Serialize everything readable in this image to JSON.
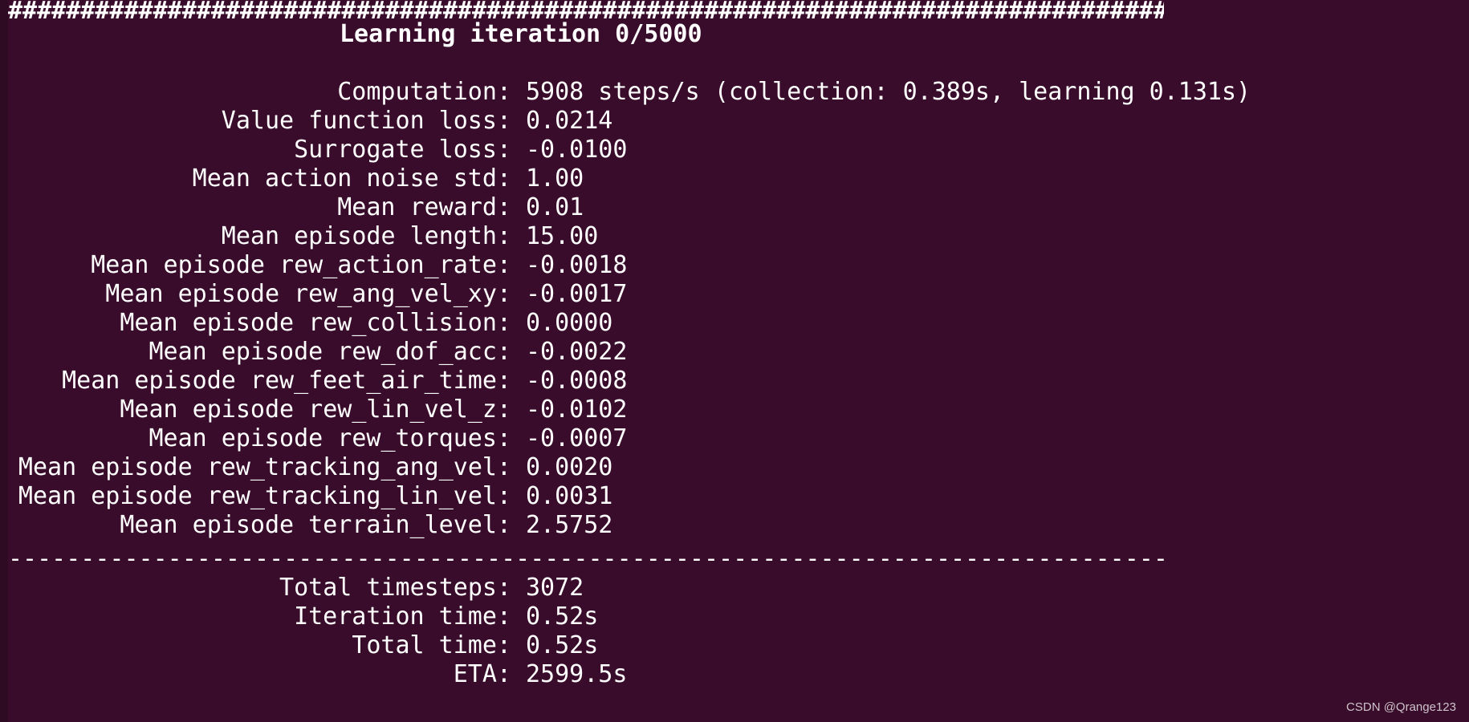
{
  "header": {
    "hash_rule": "################################################################################",
    "title": "Learning iteration 0/5000"
  },
  "stats": [
    {
      "label": "Computation:",
      "value": "5908 steps/s (collection: 0.389s, learning 0.131s)"
    },
    {
      "label": "Value function loss:",
      "value": "0.0214"
    },
    {
      "label": "Surrogate loss:",
      "value": "-0.0100"
    },
    {
      "label": "Mean action noise std:",
      "value": "1.00"
    },
    {
      "label": "Mean reward:",
      "value": "0.01"
    },
    {
      "label": "Mean episode length:",
      "value": "15.00"
    },
    {
      "label": "Mean episode rew_action_rate:",
      "value": "-0.0018"
    },
    {
      "label": "Mean episode rew_ang_vel_xy:",
      "value": "-0.0017"
    },
    {
      "label": "Mean episode rew_collision:",
      "value": "0.0000"
    },
    {
      "label": "Mean episode rew_dof_acc:",
      "value": "-0.0022"
    },
    {
      "label": "Mean episode rew_feet_air_time:",
      "value": "-0.0008"
    },
    {
      "label": "Mean episode rew_lin_vel_z:",
      "value": "-0.0102"
    },
    {
      "label": "Mean episode rew_torques:",
      "value": "-0.0007"
    },
    {
      "label": "Mean episode rew_tracking_ang_vel:",
      "value": "0.0020"
    },
    {
      "label": "Mean episode rew_tracking_lin_vel:",
      "value": "0.0031"
    },
    {
      "label": "Mean episode terrain_level:",
      "value": "2.5752"
    }
  ],
  "divider": "--------------------------------------------------------------------------------",
  "summary": [
    {
      "label": "Total timesteps:",
      "value": "3072"
    },
    {
      "label": "Iteration time:",
      "value": "0.52s"
    },
    {
      "label": "Total time:",
      "value": "0.52s"
    },
    {
      "label": "ETA:",
      "value": "2599.5s"
    }
  ],
  "watermark": "CSDN @Qrange123",
  "colors": {
    "background": "#380c2a",
    "foreground": "#ffffff"
  }
}
